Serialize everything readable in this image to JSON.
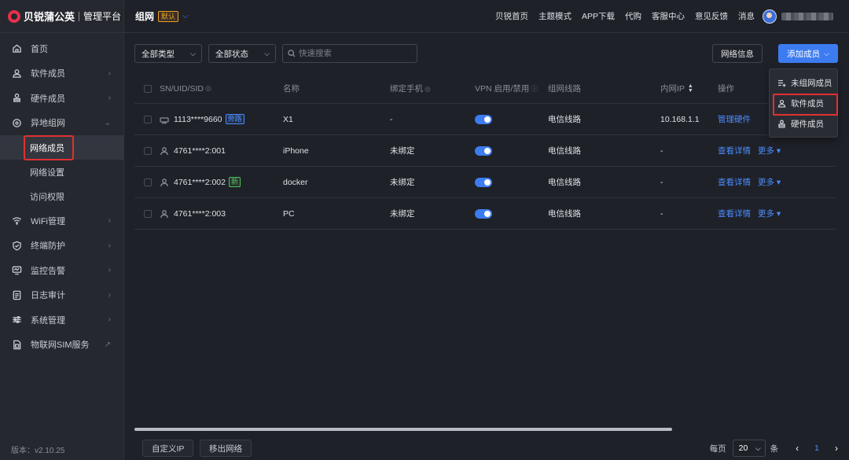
{
  "brand": {
    "name": "贝锐蒲公英",
    "subtitle": "管理平台"
  },
  "sidebar": {
    "items": [
      {
        "label": "首页",
        "icon": "home-icon"
      },
      {
        "label": "软件成员",
        "icon": "user-icon",
        "arrow": "›"
      },
      {
        "label": "硬件成员",
        "icon": "hardware-user-icon",
        "arrow": "›"
      },
      {
        "label": "异地组网",
        "icon": "network-icon",
        "arrow": "⌄"
      },
      {
        "label": "WiFi管理",
        "icon": "wifi-icon",
        "arrow": "›"
      },
      {
        "label": "终端防护",
        "icon": "shield-icon",
        "arrow": "›"
      },
      {
        "label": "监控告警",
        "icon": "monitor-icon",
        "arrow": "›"
      },
      {
        "label": "日志审计",
        "icon": "log-icon",
        "arrow": "›"
      },
      {
        "label": "系统管理",
        "icon": "settings-sliders-icon",
        "arrow": "›"
      },
      {
        "label": "物联网SIM服务",
        "icon": "sim-icon",
        "arrow": "↗"
      }
    ],
    "subitems": [
      "网络成员",
      "网络设置",
      "访问权限"
    ],
    "version": "版本：v2.10.25"
  },
  "header": {
    "title": "组网",
    "badge": "默认",
    "links": [
      "贝锐首页",
      "主题模式",
      "APP下载",
      "代购",
      "客服中心",
      "意见反馈",
      "消息"
    ]
  },
  "toolbar": {
    "type_select": "全部类型",
    "status_select": "全部状态",
    "search_placeholder": "快速搜索",
    "network_info": "网络信息",
    "add_member": "添加成员"
  },
  "dropdown": {
    "items": [
      "未组网成员",
      "软件成员",
      "硬件成员"
    ]
  },
  "table": {
    "headers": {
      "sn": "SN/UID/SID",
      "name": "名称",
      "phone": "绑定手机",
      "vpn": "VPN 启用/禁用",
      "line": "组网线路",
      "ip": "内网IP",
      "op": "操作"
    },
    "rows": [
      {
        "sn": "1113****9660",
        "tag": "旁路",
        "name": "X1",
        "phone": "-",
        "line": "电信线路",
        "ip": "10.168.1.1",
        "op": "管理硬件",
        "more": ""
      },
      {
        "sn": "4761****2:001",
        "tag": "",
        "name": "iPhone",
        "phone": "未绑定",
        "line": "电信线路",
        "ip": "-",
        "op": "查看详情",
        "more": "更多"
      },
      {
        "sn": "4761****2:002",
        "tag": "新",
        "name": "docker",
        "phone": "未绑定",
        "line": "电信线路",
        "ip": "-",
        "op": "查看详情",
        "more": "更多"
      },
      {
        "sn": "4761****2:003",
        "tag": "",
        "name": "PC",
        "phone": "未绑定",
        "line": "电信线路",
        "ip": "-",
        "op": "查看详情",
        "more": "更多"
      }
    ]
  },
  "footer": {
    "custom_ip": "自定义IP",
    "remove_network": "移出网络",
    "per_page": "每页",
    "page_size": "20",
    "unit": "条",
    "current_page": "1"
  },
  "colors": {
    "accent": "#3c7cf0",
    "highlight_border": "#e03131",
    "badge_orange": "#f0a020",
    "tag_green": "#4fbf5b"
  }
}
